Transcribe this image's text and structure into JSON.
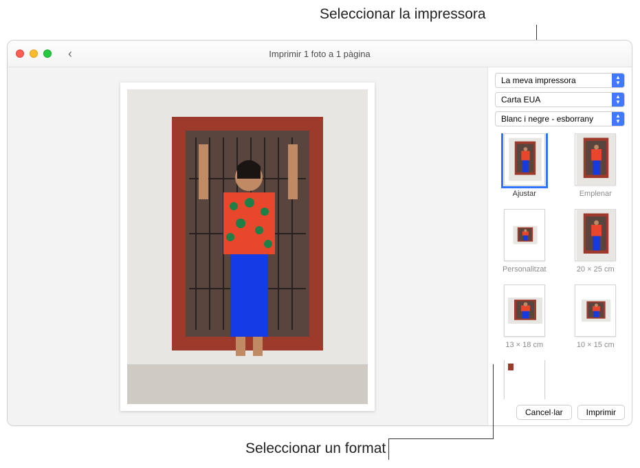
{
  "annotations": {
    "top": "Seleccionar la impressora",
    "bottom": "Seleccionar un format"
  },
  "window": {
    "title": "Imprimir 1 foto a 1 pàgina"
  },
  "selects": {
    "printer": "La meva impressora",
    "paper": "Carta EUA",
    "quality": "Blanc i negre - esborrany"
  },
  "formats": [
    {
      "key": "fit",
      "label": "Ajustar",
      "selected": true
    },
    {
      "key": "fill",
      "label": "Emplenar",
      "selected": false
    },
    {
      "key": "custom",
      "label": "Personalitzat",
      "selected": false
    },
    {
      "key": "20x25",
      "label": "20 × 25 cm",
      "selected": false
    },
    {
      "key": "13x18",
      "label": "13 × 18 cm",
      "selected": false
    },
    {
      "key": "10x15",
      "label": "10 × 15 cm",
      "selected": false
    },
    {
      "key": "contact",
      "label": "",
      "selected": false
    }
  ],
  "buttons": {
    "cancel": "Cancel·lar",
    "print": "Imprimir"
  }
}
